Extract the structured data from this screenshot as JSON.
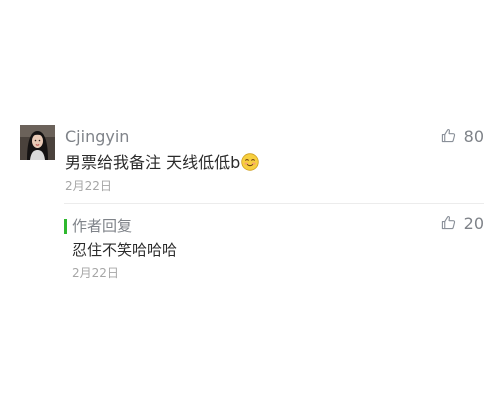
{
  "comment": {
    "username": "Cjingyin",
    "content": "男票给我备注 天线低低b",
    "emoji": "smiling-face-emoji",
    "date": "2月22日",
    "likes": "80"
  },
  "reply": {
    "author_label": "作者回复",
    "content": "忍住不笑哈哈哈",
    "date": "2月22日",
    "likes": "20"
  },
  "colors": {
    "accent_green": "#2eb82e",
    "meta_gray": "#7f8389",
    "text_dark": "#2b2b2b"
  }
}
